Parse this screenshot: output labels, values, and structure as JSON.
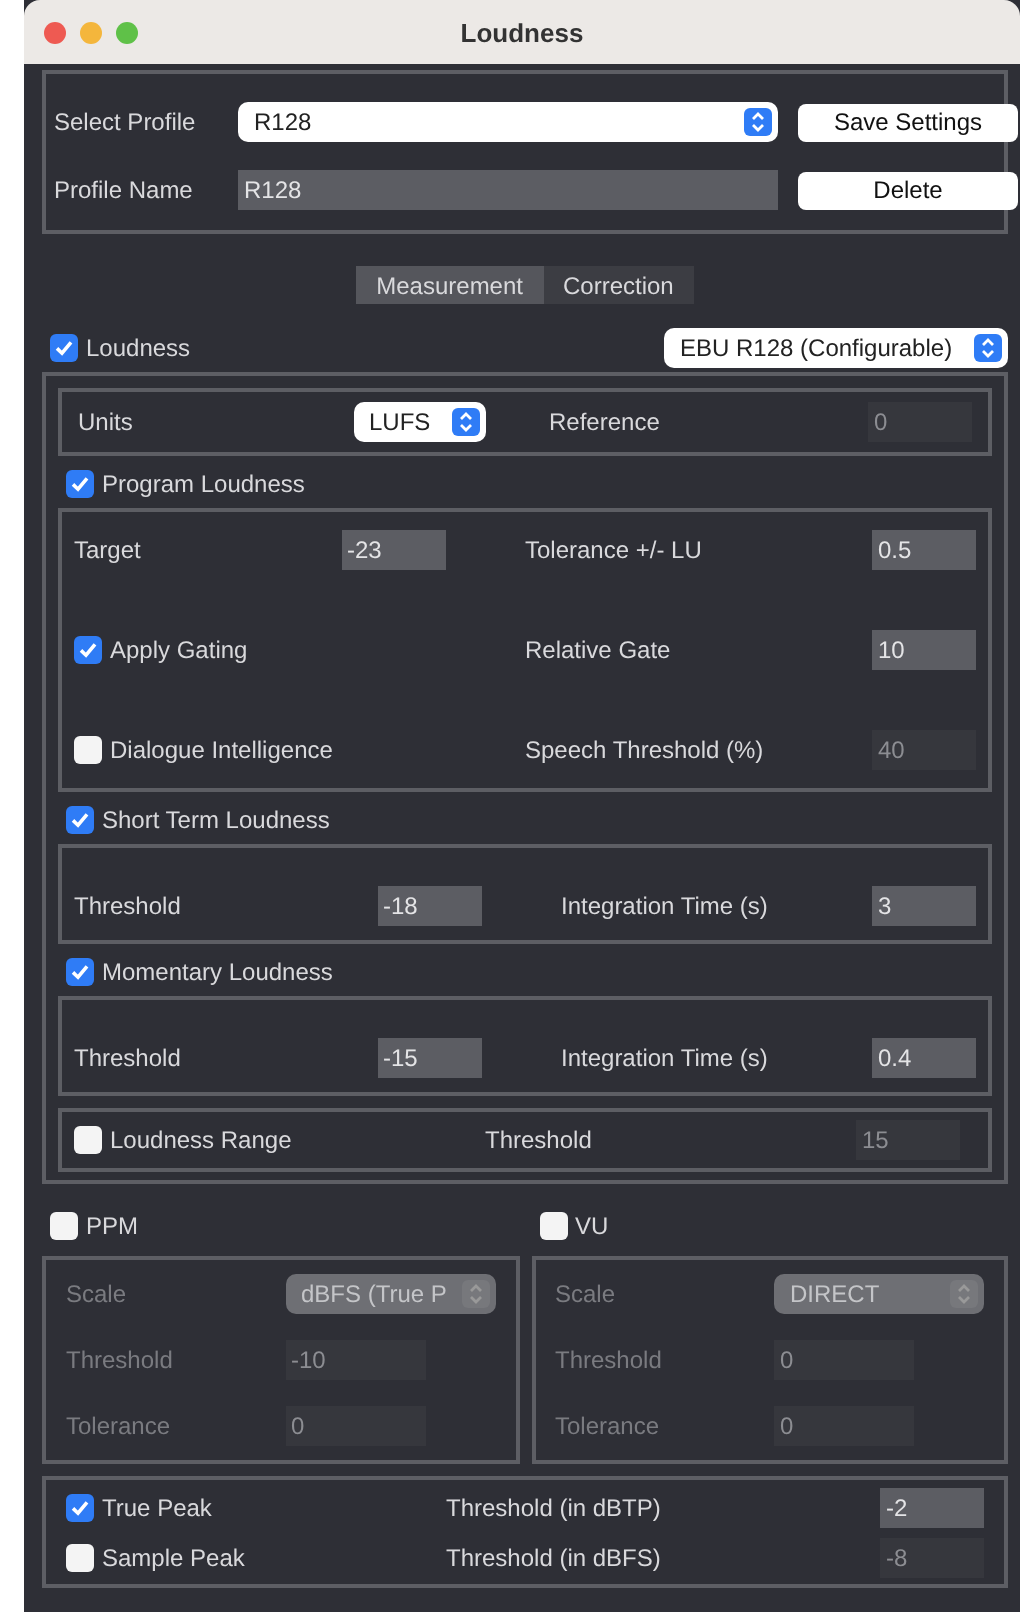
{
  "window": {
    "title": "Loudness"
  },
  "profile": {
    "select_label": "Select Profile",
    "selected": "R128",
    "name_label": "Profile Name",
    "name_value": "R128",
    "buttons": [
      "Save Settings",
      "Delete"
    ]
  },
  "tabs": [
    {
      "label": "Measurement",
      "selected": true
    },
    {
      "label": "Correction",
      "selected": false
    }
  ],
  "loudness": {
    "label": "Loudness",
    "checked": true,
    "standard": "EBU R128 (Configurable)",
    "units": {
      "label": "Units",
      "value": "LUFS",
      "reference_label": "Reference",
      "reference_value": "0"
    },
    "sections": [
      {
        "label": "Program Loudness",
        "checked": true,
        "rows": [
          {
            "left": {
              "kind": "field",
              "label": "Target",
              "value": "-23"
            },
            "right": {
              "label": "Tolerance +/- LU",
              "value": "0.5",
              "disabled": false
            }
          },
          {
            "left": {
              "kind": "check",
              "label": "Apply Gating",
              "checked": true
            },
            "right": {
              "label": "Relative Gate",
              "value": "10",
              "disabled": false
            }
          },
          {
            "left": {
              "kind": "check",
              "label": "Dialogue Intelligence",
              "checked": false
            },
            "right": {
              "label": "Speech Threshold (%)",
              "value": "40",
              "disabled": true
            }
          }
        ]
      },
      {
        "label": "Short Term Loudness",
        "checked": true,
        "rows": [
          {
            "left": {
              "kind": "field",
              "label": "Threshold",
              "value": "-18"
            },
            "right": {
              "label": "Integration Time (s)",
              "value": "3",
              "disabled": false
            }
          }
        ]
      },
      {
        "label": "Momentary Loudness",
        "checked": true,
        "rows": [
          {
            "left": {
              "kind": "field",
              "label": "Threshold",
              "value": "-15"
            },
            "right": {
              "label": "Integration Time (s)",
              "value": "0.4",
              "disabled": false
            }
          }
        ]
      }
    ],
    "range": {
      "label": "Loudness Range",
      "checked": false,
      "threshold_label": "Threshold",
      "threshold_value": "15"
    }
  },
  "meters": [
    {
      "label": "PPM",
      "checked": false,
      "scale_label": "Scale",
      "scale": "dBFS (True P",
      "threshold_label": "Threshold",
      "threshold": "-10",
      "tolerance_label": "Tolerance",
      "tolerance": "0"
    },
    {
      "label": "VU",
      "checked": false,
      "scale_label": "Scale",
      "scale": "DIRECT",
      "threshold_label": "Threshold",
      "threshold": "0",
      "tolerance_label": "Tolerance",
      "tolerance": "0"
    }
  ],
  "peaks": [
    {
      "label": "True Peak",
      "checked": true,
      "threshold_label": "Threshold (in dBTP)",
      "value": "-2"
    },
    {
      "label": "Sample Peak",
      "checked": false,
      "threshold_label": "Threshold (in dBFS)",
      "value": "-8"
    }
  ]
}
